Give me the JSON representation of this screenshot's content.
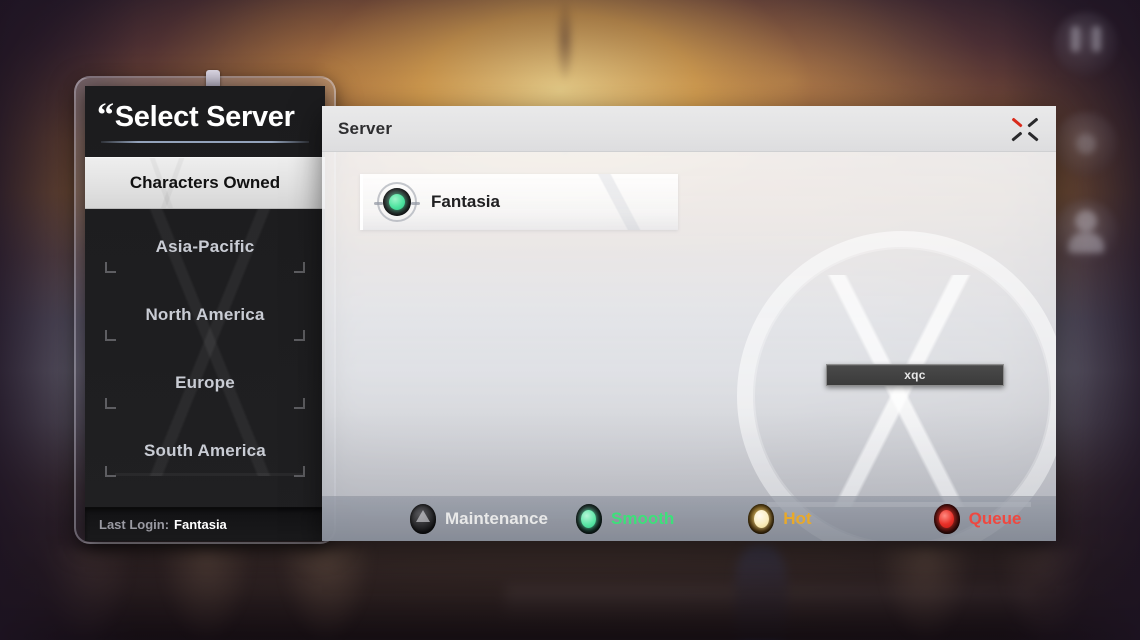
{
  "sidebar": {
    "title": "Select Server",
    "quote_glyph": "“",
    "selected_tab": "Characters Owned",
    "regions": [
      {
        "label": "Asia-Pacific"
      },
      {
        "label": "North America"
      },
      {
        "label": "Europe"
      },
      {
        "label": "South America"
      }
    ],
    "footer": {
      "label": "Last Login:",
      "value": "Fantasia"
    }
  },
  "server_panel": {
    "header_title": "Server",
    "close_icon": "close-x-icon",
    "servers": [
      {
        "name": "Fantasia",
        "status": "Smooth",
        "status_color": "#4fe3a0",
        "gem_icon": "server-status-gem-icon"
      }
    ],
    "tooltip": {
      "text": "xqc"
    }
  },
  "legend": {
    "items": [
      {
        "label": "Maintenance",
        "text_color": "#e8e8e8",
        "gem_color": "#2a2a2c",
        "ring_color": "#111113",
        "icon": "maintenance-gem-icon"
      },
      {
        "label": "Smooth",
        "text_color": "#3de07a",
        "gem_color": "#5fe8a8",
        "ring_color": "#16302a",
        "icon": "smooth-gem-icon"
      },
      {
        "label": "Hot",
        "text_color": "#e8a92a",
        "gem_color": "#fbeec0",
        "ring_color": "#6a4a12",
        "icon": "hot-gem-icon"
      },
      {
        "label": "Queue",
        "text_color": "#ef4840",
        "gem_color": "#e83028",
        "ring_color": "#4a1210",
        "icon": "queue-gem-icon"
      }
    ]
  },
  "background": {
    "hud_icons": [
      {
        "name": "horns-icon"
      },
      {
        "name": "ring-icon"
      },
      {
        "name": "character-icon"
      }
    ]
  }
}
